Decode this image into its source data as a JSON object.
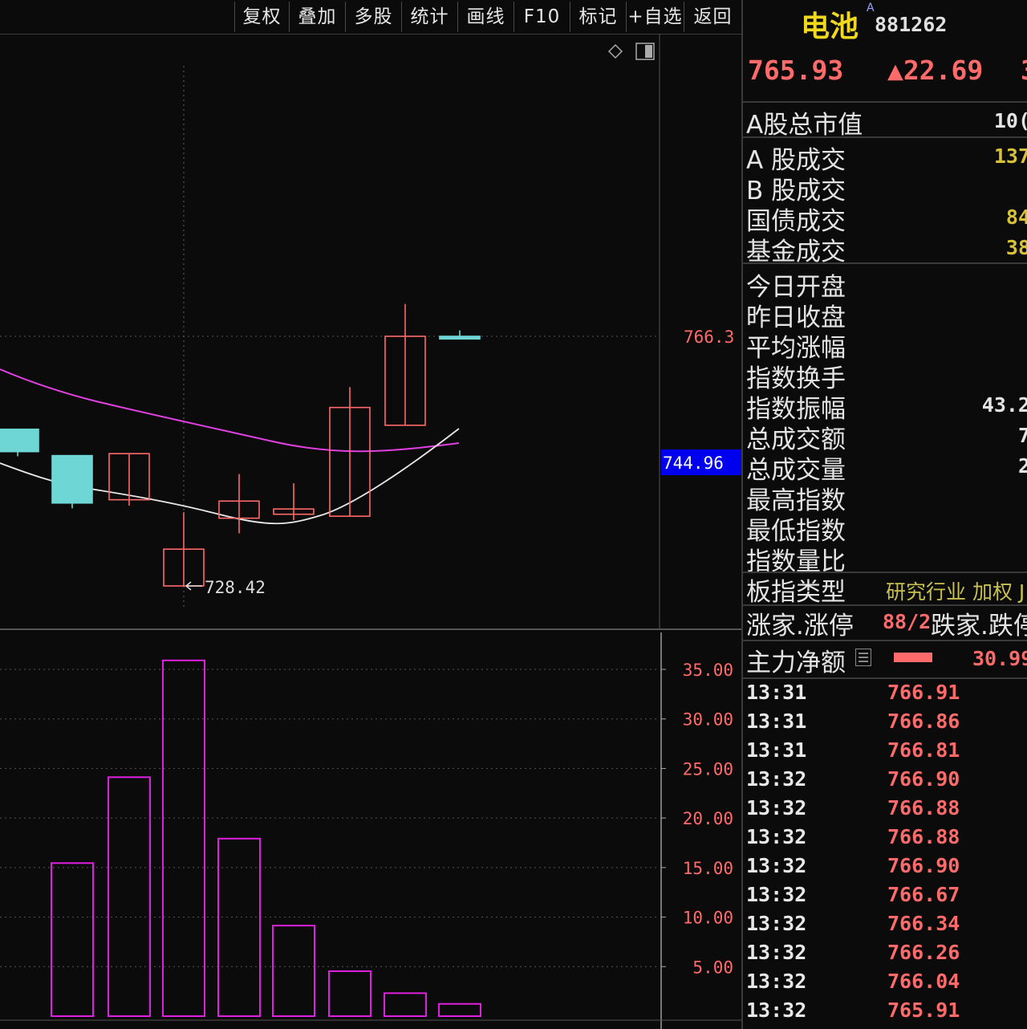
{
  "toolbar": {
    "buttons": [
      "复权",
      "叠加",
      "多股",
      "统计",
      "画线",
      "F10",
      "标记",
      "+自选",
      "返回"
    ]
  },
  "chart": {
    "price_axis_labels": {
      "upper": "766.3",
      "current": "744.96"
    },
    "low_marker": "728.42",
    "volume_axis_labels": [
      "35.00",
      "30.00",
      "25.00",
      "20.00",
      "15.00",
      "10.00",
      "5.00"
    ]
  },
  "chart_data": {
    "type": "candlestick",
    "price_ylim": [
      720,
      790
    ],
    "candles": [
      {
        "open": 752.2,
        "close": 748.8,
        "high": 752.2,
        "low": 748.1,
        "color": "cyan"
      },
      {
        "open": 748.2,
        "close": 741.0,
        "high": 748.2,
        "low": 740.2,
        "color": "cyan"
      },
      {
        "open": 741.5,
        "close": 748.5,
        "high": 748.5,
        "low": 740.6,
        "color": "red"
      },
      {
        "open": 728.42,
        "close": 734.0,
        "high": 739.6,
        "low": 728.42,
        "color": "red"
      },
      {
        "open": 738.7,
        "close": 741.3,
        "high": 745.4,
        "low": 736.4,
        "color": "red"
      },
      {
        "open": 739.3,
        "close": 740.1,
        "high": 744.0,
        "low": 738.4,
        "color": "red"
      },
      {
        "open": 739.0,
        "close": 755.5,
        "high": 758.6,
        "low": 739.0,
        "color": "red"
      },
      {
        "open": 752.8,
        "close": 766.3,
        "high": 771.2,
        "low": 752.8,
        "color": "red"
      },
      {
        "open": 765.9,
        "close": 766.3,
        "high": 767.2,
        "low": 765.9,
        "color": "cyan"
      }
    ],
    "volume_ylim": [
      0,
      38
    ],
    "volumes": [
      15.45,
      24.12,
      35.91,
      17.92,
      9.14,
      4.54,
      2.32,
      1.24
    ],
    "series": [
      {
        "name": "MA-white",
        "color": "#e8e8e8"
      },
      {
        "name": "MA-magenta",
        "color": "#e040e0"
      }
    ]
  },
  "panel": {
    "name": "电池",
    "name_sup": "A",
    "code": "881262",
    "price": "765.93",
    "change": "▲22.69",
    "change_cut": "3",
    "rows_group1": [
      {
        "label": "A股总市值",
        "value": "10("
      }
    ],
    "rows_group2": [
      {
        "label": "A 股成交",
        "value": "137"
      },
      {
        "label": "B 股成交",
        "value": ""
      },
      {
        "label": "国债成交",
        "value": "84"
      },
      {
        "label": "基金成交",
        "value": "38"
      }
    ],
    "rows_group3": [
      {
        "label": "今日开盘",
        "value": ""
      },
      {
        "label": "昨日收盘",
        "value": ""
      },
      {
        "label": "平均涨幅",
        "value": ""
      },
      {
        "label": "指数换手",
        "value": ""
      },
      {
        "label": "指数振幅",
        "value": "43.2"
      },
      {
        "label": "总成交额",
        "value": "7"
      },
      {
        "label": "总成交量",
        "value": "2"
      },
      {
        "label": "最高指数",
        "value": ""
      },
      {
        "label": "最低指数",
        "value": ""
      },
      {
        "label": "指数量比",
        "value": ""
      }
    ],
    "board_type_label": "板指类型",
    "board_type_value": "研究行业 加权 J",
    "updown_label": "涨家.涨停",
    "updown_value": "88/2",
    "down_label": "跌家.跌停",
    "main_flow_label": "主力净额",
    "main_flow_value": "30.99",
    "ticks": [
      {
        "time": "13:31",
        "price": "766.91"
      },
      {
        "time": "13:31",
        "price": "766.86"
      },
      {
        "time": "13:31",
        "price": "766.81"
      },
      {
        "time": "13:32",
        "price": "766.90"
      },
      {
        "time": "13:32",
        "price": "766.88"
      },
      {
        "time": "13:32",
        "price": "766.88"
      },
      {
        "time": "13:32",
        "price": "766.90"
      },
      {
        "time": "13:32",
        "price": "766.67"
      },
      {
        "time": "13:32",
        "price": "766.34"
      },
      {
        "time": "13:32",
        "price": "766.26"
      },
      {
        "time": "13:32",
        "price": "766.04"
      },
      {
        "time": "13:32",
        "price": "765.91"
      }
    ]
  },
  "colors": {
    "up": "#ff6a6a",
    "down": "#6fd6d6",
    "volume": "#e020e0",
    "highlight_bg": "#0000ee"
  }
}
